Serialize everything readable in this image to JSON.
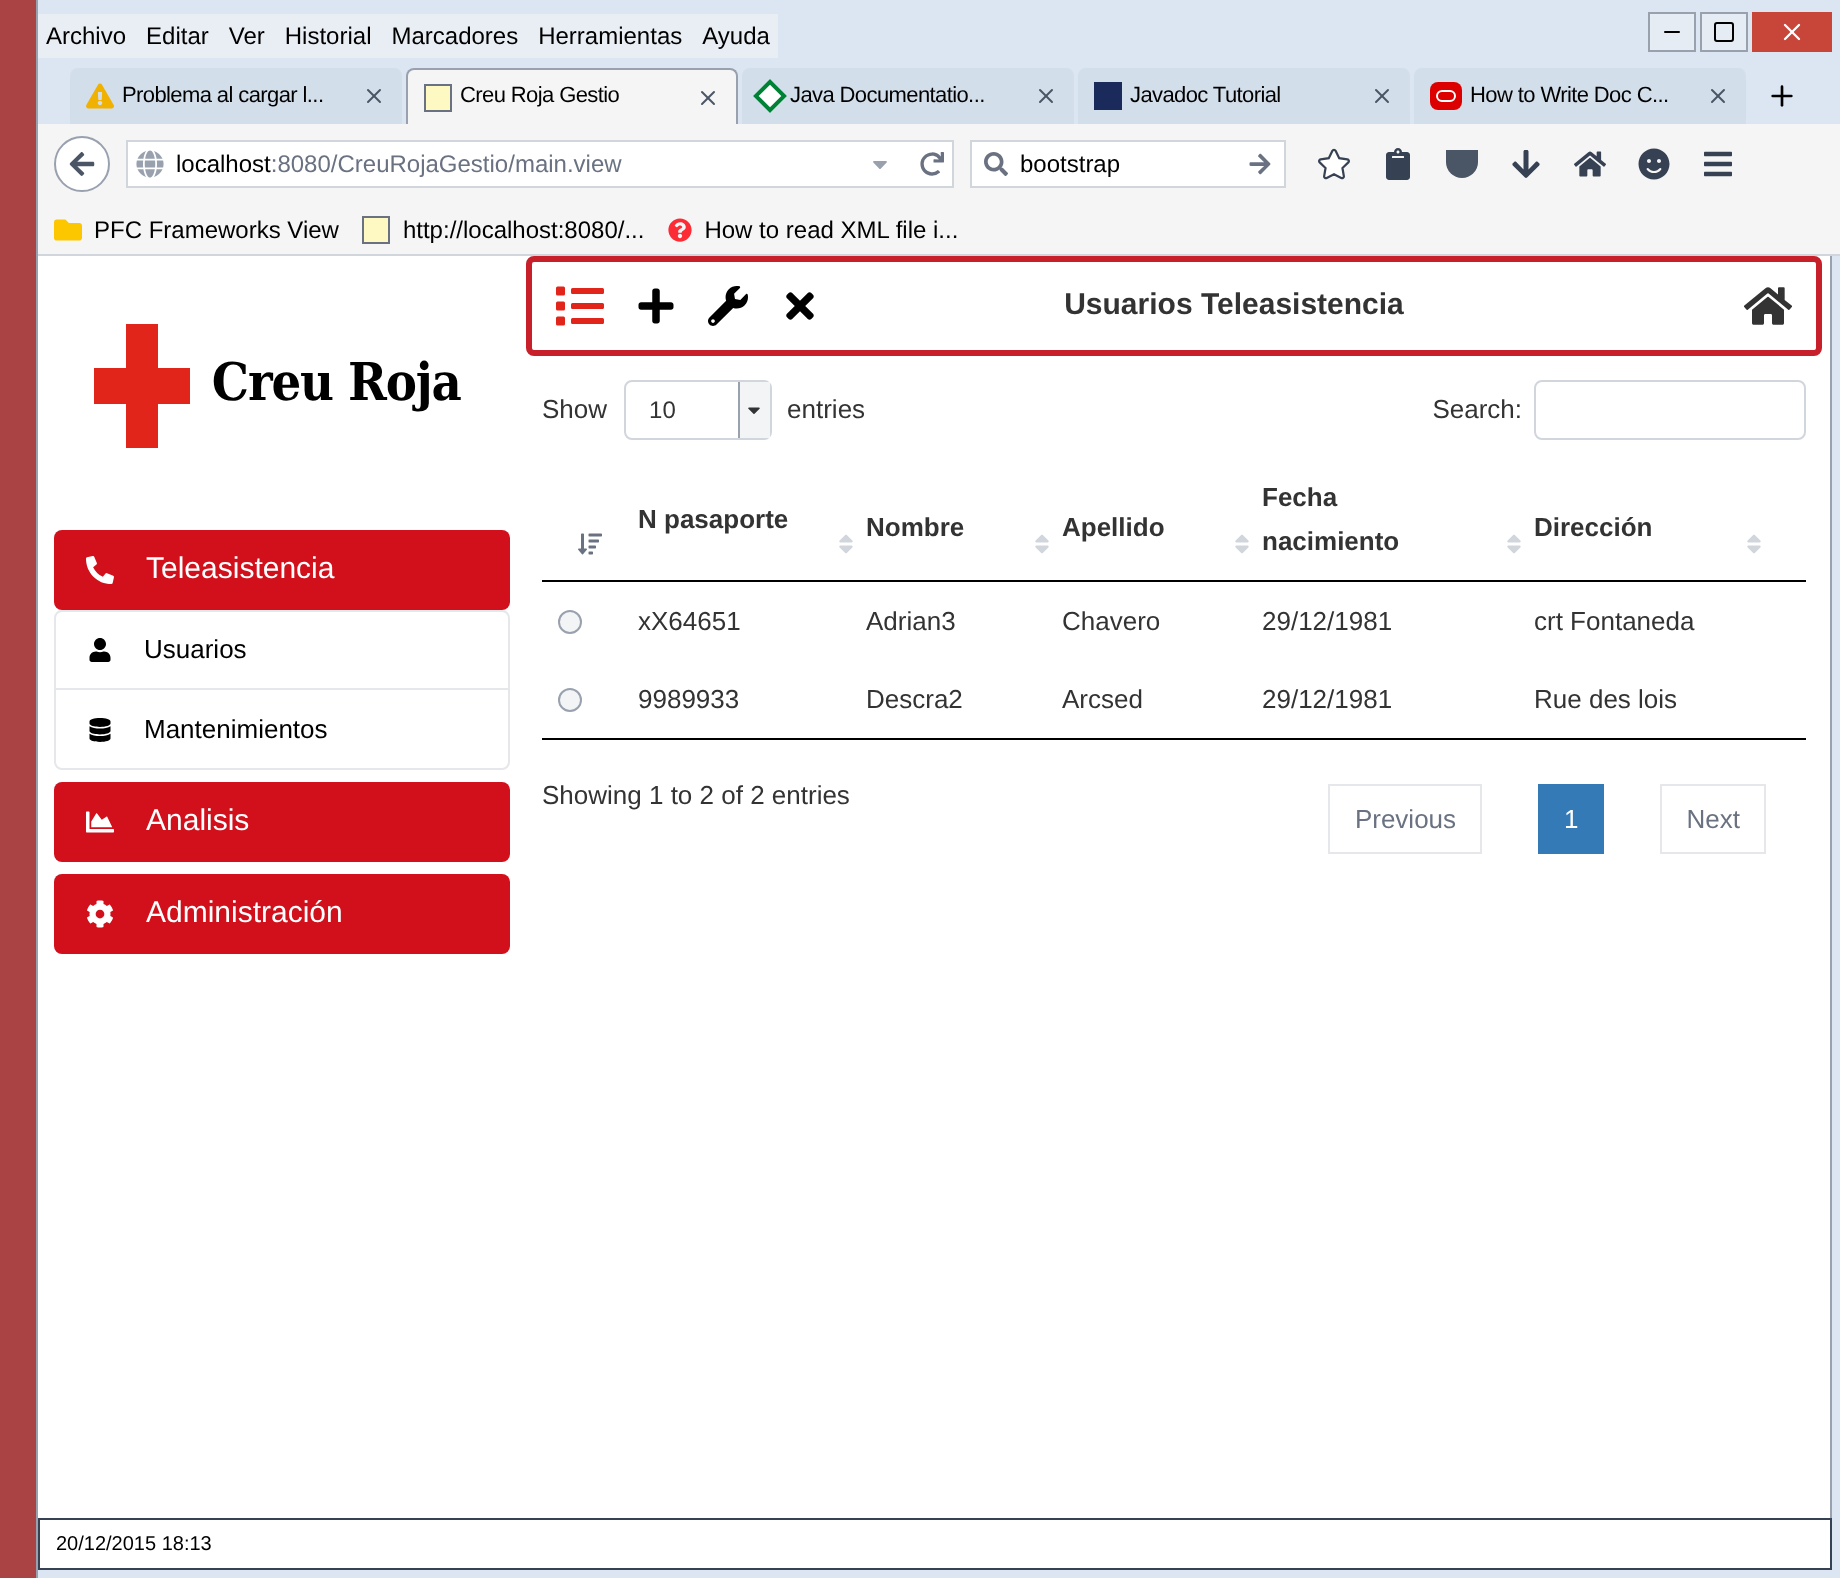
{
  "menu": [
    "Archivo",
    "Editar",
    "Ver",
    "Historial",
    "Marcadores",
    "Herramientas",
    "Ayuda"
  ],
  "tabs": [
    {
      "title": "Problema al cargar l...",
      "selected": false,
      "kind": "warning"
    },
    {
      "title": "Creu Roja Gestio",
      "selected": true,
      "kind": "site"
    },
    {
      "title": "Java Documentatio...",
      "selected": false,
      "kind": "java"
    },
    {
      "title": "Javadoc Tutorial",
      "selected": false,
      "kind": "cs"
    },
    {
      "title": "How to Write Doc C...",
      "selected": false,
      "kind": "oracle"
    }
  ],
  "url": {
    "host": "localhost",
    "rest": ":8080/CreuRojaGestio/main.view"
  },
  "web_search": {
    "value": "bootstrap"
  },
  "bookmarks": [
    {
      "title": "PFC Frameworks View",
      "kind": "folder"
    },
    {
      "title": "http://localhost:8080/...",
      "kind": "site"
    },
    {
      "title": "How to read XML file i...",
      "kind": "help"
    }
  ],
  "logo": {
    "text": "Creu Roja"
  },
  "sidebar": [
    {
      "label": "Teleasistencia",
      "kind": "section"
    },
    {
      "label": "Usuarios",
      "kind": "subitem"
    },
    {
      "label": "Mantenimientos",
      "kind": "subitem"
    },
    {
      "label": "Analisis",
      "kind": "section"
    },
    {
      "label": "Administración",
      "kind": "section"
    }
  ],
  "toolbar": {
    "title": "Usuarios Teleasistencia"
  },
  "length": {
    "show": "Show",
    "value": "10",
    "entries": "entries"
  },
  "search": {
    "label": "Search:"
  },
  "table": {
    "columns": [
      "N pasaporte",
      "Nombre",
      "Apellido",
      "Fecha nacimiento",
      "Dirección"
    ],
    "rows": [
      {
        "selected": false,
        "cells": [
          "xX64651",
          "Adrian3",
          "Chavero",
          "29/12/1981",
          "crt Fontaneda"
        ]
      },
      {
        "selected": false,
        "cells": [
          "9989933",
          "Descra2",
          "Arcsed",
          "29/12/1981",
          "Rue des lois"
        ]
      }
    ]
  },
  "info": "Showing 1 to 2 of 2 entries",
  "pagination": [
    {
      "label": "Previous",
      "selected": false
    },
    {
      "label": "1",
      "selected": true
    },
    {
      "label": "Next",
      "selected": false
    }
  ],
  "status_bar": "20/12/2015 18:13"
}
